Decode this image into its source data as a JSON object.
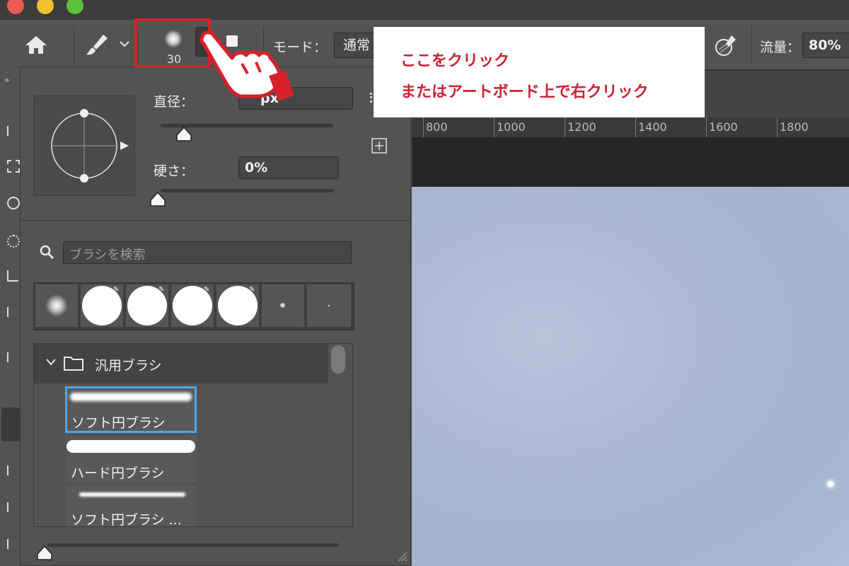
{
  "optionsbar": {
    "brush_size": "30",
    "mode_label": "モード：",
    "mode_value": "通常",
    "flow_label": "流量：",
    "flow_value": "80%"
  },
  "panel": {
    "diameter_label": "直径：",
    "diameter_value": "px",
    "hardness_label": "硬さ：",
    "hardness_value": "0%",
    "search_placeholder": "ブラシを検索",
    "folder_name": "汎用ブラシ",
    "brushes": [
      {
        "name": "ソフト円ブラシ"
      },
      {
        "name": "ハード円ブラシ"
      },
      {
        "name": "ソフト円ブラシ ..."
      }
    ]
  },
  "ruler": {
    "ticks": [
      "800",
      "1000",
      "1200",
      "1400",
      "1600",
      "1800"
    ]
  },
  "callout": {
    "line1": "ここをクリック",
    "line2": "またはアートボード上で右クリック"
  },
  "colors": {
    "accent_red": "#cc2233",
    "selection_blue": "#4aa8e6",
    "panel_bg": "#535353"
  }
}
